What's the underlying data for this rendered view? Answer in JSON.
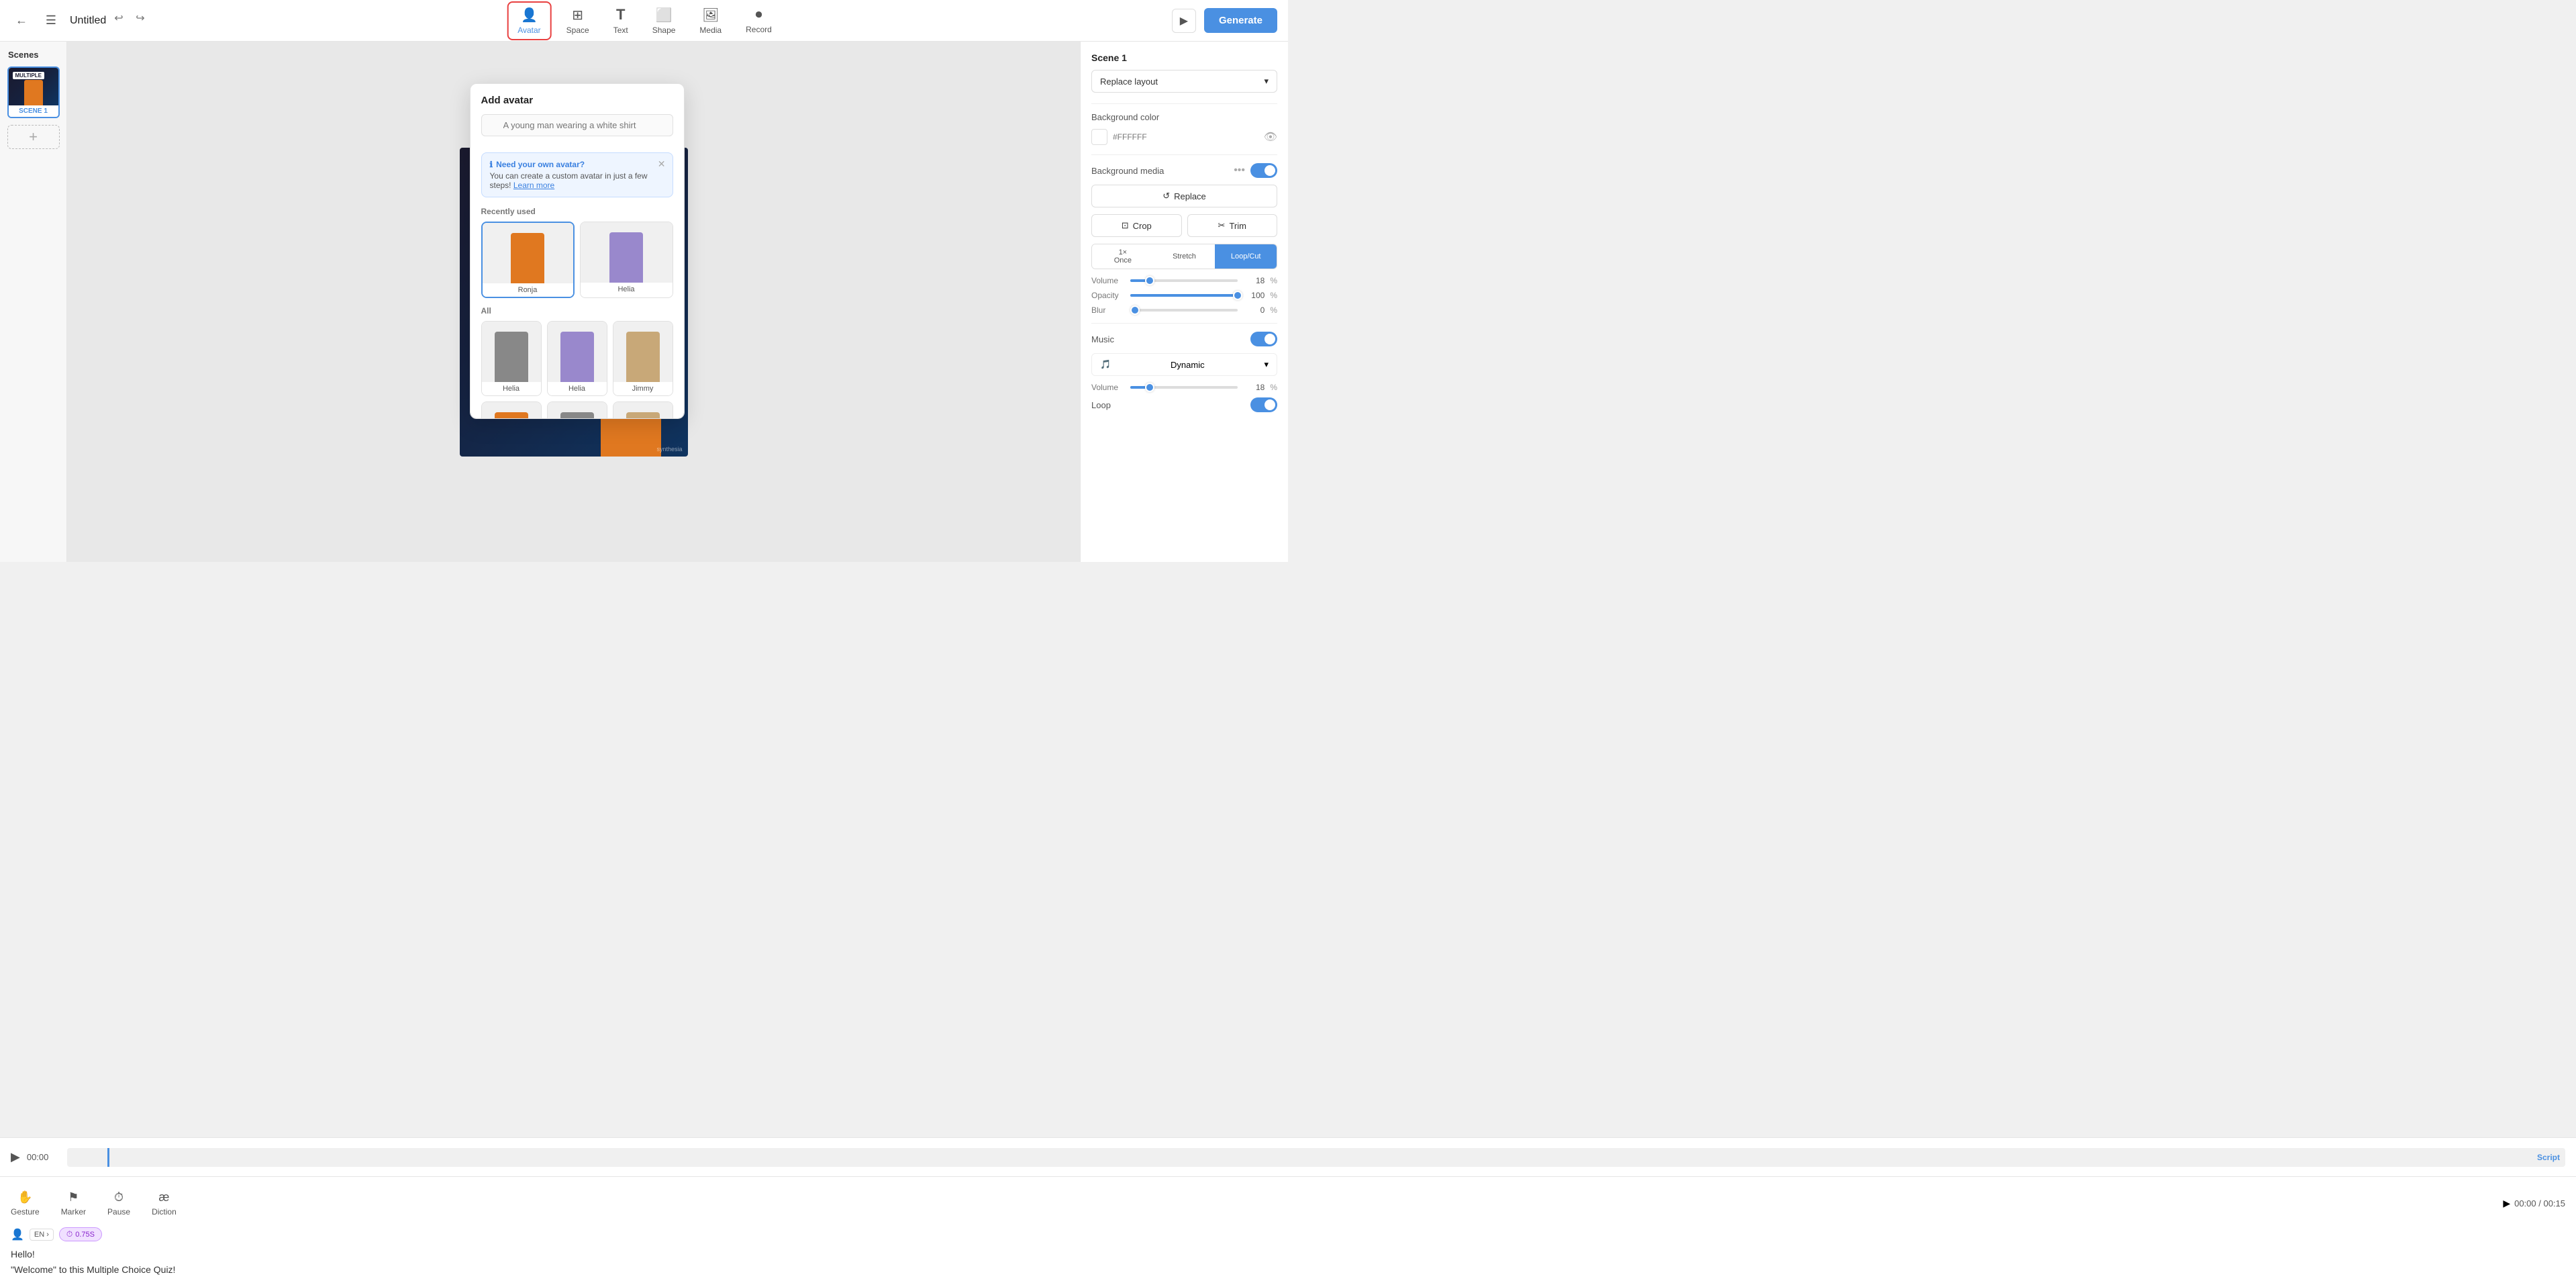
{
  "app": {
    "title": "Untitled"
  },
  "topbar": {
    "back_label": "←",
    "menu_label": "☰",
    "undo_label": "↩",
    "redo_label": "↪",
    "play_icon": "▶",
    "generate_label": "Generate"
  },
  "nav_tools": [
    {
      "id": "avatar",
      "label": "Avatar",
      "icon": "👤",
      "active": true
    },
    {
      "id": "space",
      "label": "Space",
      "icon": "⊞"
    },
    {
      "id": "text",
      "label": "Text",
      "icon": "T"
    },
    {
      "id": "shape",
      "label": "Shape",
      "icon": "⬜"
    },
    {
      "id": "media",
      "label": "Media",
      "icon": "🖼"
    },
    {
      "id": "record",
      "label": "Record",
      "icon": "⏺"
    }
  ],
  "scenes": {
    "label": "Scenes",
    "items": [
      {
        "id": "scene1",
        "label": "SCENE 1",
        "active": true
      }
    ],
    "add_label": "+"
  },
  "avatar_panel": {
    "title": "Add avatar",
    "search_placeholder": "A young man wearing a white shirt",
    "info_banner": {
      "title": "Need your own avatar?",
      "body": "You can create a custom avatar in just a few steps!",
      "link_text": "Learn more"
    },
    "recently_used_label": "Recently used",
    "all_label": "All",
    "recently_used": [
      {
        "name": "Ronja",
        "color": "#e07820",
        "selected": true
      },
      {
        "name": "Helia",
        "color": "#9988cc"
      }
    ],
    "all_avatars": [
      {
        "name": "Helia",
        "color": "#888"
      },
      {
        "name": "Helia",
        "color": "#9988cc"
      },
      {
        "name": "Jimmy",
        "color": "#c8a878"
      },
      {
        "name": "",
        "color": "#e07820"
      },
      {
        "name": "",
        "color": "#888"
      },
      {
        "name": "",
        "color": "#c8a878"
      }
    ]
  },
  "right_panel": {
    "scene_title": "Scene 1",
    "replace_layout_label": "Replace layout",
    "background_color_label": "Background color",
    "background_color_value": "#FFFFFF",
    "background_media_label": "Background media",
    "replace_label": "Replace",
    "replace_icon": "↺",
    "crop_label": "Crop",
    "crop_icon": "⊡",
    "trim_label": "Trim",
    "trim_icon": "✂",
    "once_label": "Once",
    "once_icon": "1×",
    "stretch_label": "Stretch",
    "loop_cut_label": "Loop/Cut",
    "volume_label": "Volume",
    "volume_value": "18",
    "volume_unit": "%",
    "opacity_label": "Opacity",
    "opacity_value": "100",
    "opacity_unit": "%",
    "blur_label": "Blur",
    "blur_value": "0",
    "blur_unit": "%",
    "music_label": "Music",
    "music_track": "Dynamic",
    "music_volume_label": "Volume",
    "music_volume_value": "18",
    "music_volume_unit": "%",
    "loop_label": "Loop"
  },
  "timeline": {
    "play_icon": "▶",
    "time_start": "00:00",
    "script_label": "Script"
  },
  "script": {
    "tools": [
      {
        "id": "gesture",
        "label": "Gesture",
        "icon": "✋"
      },
      {
        "id": "marker",
        "label": "Marker",
        "icon": "⚑"
      },
      {
        "id": "pause",
        "label": "Pause",
        "icon": "⏱"
      },
      {
        "id": "diction",
        "label": "Diction",
        "icon": "æ"
      }
    ],
    "lang": "EN",
    "time_badge": "0.75S",
    "lines": [
      "Hello!",
      "\"Welcome\" to this Multiple Choice Quiz!"
    ],
    "time_display": "00:00 / 00:15"
  },
  "watermark": "synthesia"
}
